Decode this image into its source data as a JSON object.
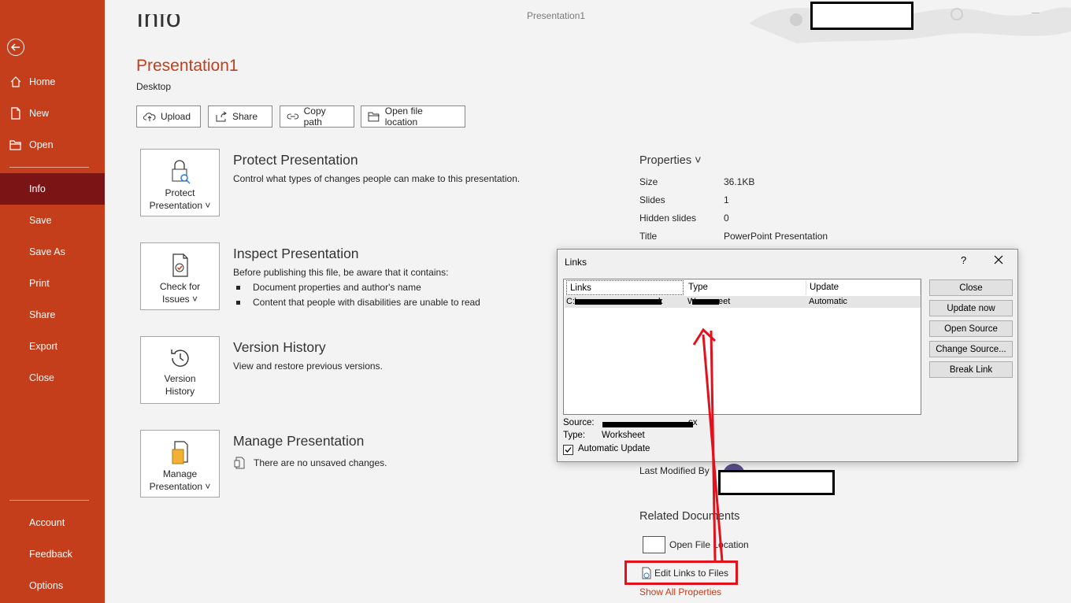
{
  "app": {
    "window_title": "Presentation1",
    "page_heading": "Info"
  },
  "sidebar": {
    "items": [
      {
        "label": "Home",
        "icon": "home-icon"
      },
      {
        "label": "New",
        "icon": "new-file-icon"
      },
      {
        "label": "Open",
        "icon": "open-folder-icon"
      },
      {
        "label": "Info"
      },
      {
        "label": "Save"
      },
      {
        "label": "Save As"
      },
      {
        "label": "Print"
      },
      {
        "label": "Share"
      },
      {
        "label": "Export"
      },
      {
        "label": "Close"
      }
    ],
    "bottom_items": [
      {
        "label": "Account"
      },
      {
        "label": "Feedback"
      },
      {
        "label": "Options"
      }
    ],
    "active": "Info"
  },
  "document": {
    "name": "Presentation1",
    "location": "Desktop"
  },
  "toolbar": {
    "upload": "Upload",
    "share": "Share",
    "copy_path": "Copy path",
    "open_location": "Open file location"
  },
  "sections": {
    "protect": {
      "btn_line1": "Protect",
      "btn_line2": "Presentation ˅",
      "title": "Protect Presentation",
      "desc": "Control what types of changes people can make to this presentation."
    },
    "inspect": {
      "btn_line1": "Check for",
      "btn_line2": "Issues ˅",
      "title": "Inspect Presentation",
      "desc": "Before publishing this file, be aware that it contains:",
      "bullets": [
        "Document properties and author's name",
        "Content that people with disabilities are unable to read"
      ]
    },
    "version": {
      "btn_line1": "Version",
      "btn_line2": "History",
      "title": "Version History",
      "desc": "View and restore previous versions."
    },
    "manage": {
      "btn_line1": "Manage",
      "btn_line2": "Presentation ˅",
      "title": "Manage Presentation",
      "desc": "There are no unsaved changes."
    }
  },
  "properties": {
    "title": "Properties ˅",
    "rows": [
      {
        "key": "Size",
        "value": "36.1KB"
      },
      {
        "key": "Slides",
        "value": "1"
      },
      {
        "key": "Hidden slides",
        "value": "0"
      },
      {
        "key": "Title",
        "value": "PowerPoint Presentation"
      }
    ],
    "last_modified_by": "Last Modified By"
  },
  "related": {
    "title": "Related Documents",
    "open_file_location": "Open File Location",
    "edit_links": "Edit Links to Files",
    "show_all": "Show All Properties"
  },
  "dialog": {
    "title": "Links",
    "help": "?",
    "columns": [
      "Links",
      "Type",
      "Update"
    ],
    "row": {
      "link_prefix": "C:\\",
      "link_suffix": "k",
      "type_prefix": "W",
      "type_suffix": "eet",
      "update": "Automatic"
    },
    "buttons": [
      "Close",
      "Update now",
      "Open Source",
      "Change Source...",
      "Break Link"
    ],
    "source_label": "Source:",
    "source_suffix": "sx",
    "type_label": "Type:",
    "type_value": "Worksheet",
    "auto_update": "Automatic Update"
  },
  "colors": {
    "accent": "#c43e1c",
    "sidebar_active": "#7b1515",
    "highlight": "#e3111b"
  }
}
